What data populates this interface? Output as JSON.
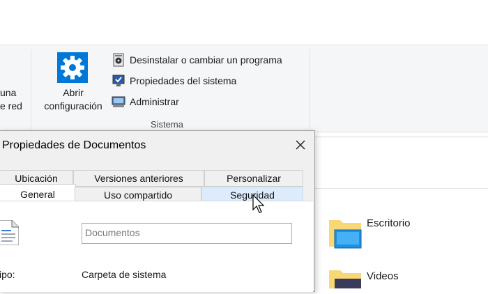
{
  "ribbon": {
    "network_label_line1": "una",
    "network_label_line2": "e red",
    "open_settings_line1": "Abrir",
    "open_settings_line2": "configuración",
    "uninstall": "Desinstalar o cambiar un programa",
    "system_properties": "Propiedades del sistema",
    "manage": "Administrar",
    "group_label": "Sistema"
  },
  "folders": [
    {
      "label": "Escritorio"
    },
    {
      "label": "Videos"
    }
  ],
  "dialog": {
    "title": "Propiedades de Documentos",
    "tabs_row1": [
      "Ubicación",
      "Versiones anteriores",
      "Personalizar"
    ],
    "tabs_row2": [
      "General",
      "Uso compartido",
      "Seguridad"
    ],
    "name_value": "Documentos",
    "type_label": "ipo:",
    "type_value": "Carpeta de sistema"
  },
  "colors": {
    "accent": "#0078d7",
    "folder": "#f8d775",
    "tab_hover": "#dcecfc"
  }
}
